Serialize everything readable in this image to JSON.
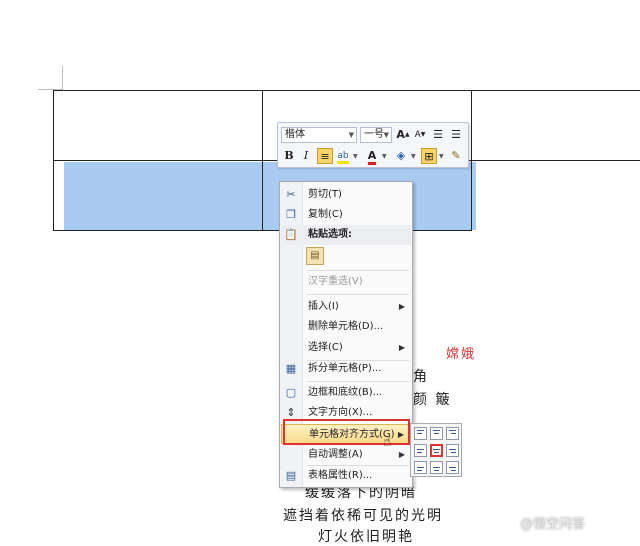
{
  "toolbar": {
    "font_name": "楷体",
    "font_size": "一号",
    "grow_font": "A",
    "shrink_font": "A",
    "bold": "B",
    "italic": "I",
    "font_color_letter": "A"
  },
  "context_menu": {
    "items": [
      {
        "label": "剪切(T)",
        "icon": "scissors-icon"
      },
      {
        "label": "复制(C)",
        "icon": "copy-icon"
      },
      {
        "label": "粘贴选项:",
        "icon": "paste-icon"
      },
      {
        "label": "汉字重选(V)"
      },
      {
        "label": "插入(I)",
        "has_submenu": true
      },
      {
        "label": "删除单元格(D)..."
      },
      {
        "label": "选择(C)",
        "has_submenu": true
      },
      {
        "label": "拆分单元格(P)...",
        "icon": "split-cells-icon"
      },
      {
        "label": "边框和底纹(B)...",
        "icon": "borders-icon"
      },
      {
        "label": "文字方向(X)...",
        "icon": "text-direction-icon"
      },
      {
        "label": "单元格对齐方式(G)",
        "has_submenu": true,
        "highlighted": true
      },
      {
        "label": "自动调整(A)",
        "has_submenu": true
      },
      {
        "label": "表格属性(R)...",
        "icon": "table-properties-icon"
      }
    ],
    "submenu_arrow": "▶"
  },
  "poem": {
    "red_text": "嫦娥",
    "line_a": "角",
    "line_b": "颜 簸",
    "line_c": "缓缓落下的阴暗",
    "line_d": "遮挡着依稀可见的光明",
    "line_e": "灯火依旧明艳"
  },
  "watermark": "@悟空问答",
  "colors": {
    "selection": "#a9cbf1",
    "highlight_border": "#e0322e",
    "menu_hover": "#fbd98a"
  }
}
